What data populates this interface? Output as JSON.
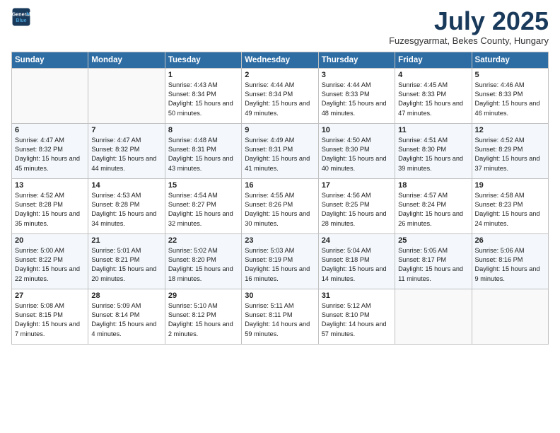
{
  "logo": {
    "line1": "General",
    "line2": "Blue"
  },
  "title": "July 2025",
  "location": "Fuzesgyarmat, Bekes County, Hungary",
  "days_of_week": [
    "Sunday",
    "Monday",
    "Tuesday",
    "Wednesday",
    "Thursday",
    "Friday",
    "Saturday"
  ],
  "weeks": [
    [
      {
        "day": "",
        "detail": ""
      },
      {
        "day": "",
        "detail": ""
      },
      {
        "day": "1",
        "detail": "Sunrise: 4:43 AM\nSunset: 8:34 PM\nDaylight: 15 hours\nand 50 minutes."
      },
      {
        "day": "2",
        "detail": "Sunrise: 4:44 AM\nSunset: 8:34 PM\nDaylight: 15 hours\nand 49 minutes."
      },
      {
        "day": "3",
        "detail": "Sunrise: 4:44 AM\nSunset: 8:33 PM\nDaylight: 15 hours\nand 48 minutes."
      },
      {
        "day": "4",
        "detail": "Sunrise: 4:45 AM\nSunset: 8:33 PM\nDaylight: 15 hours\nand 47 minutes."
      },
      {
        "day": "5",
        "detail": "Sunrise: 4:46 AM\nSunset: 8:33 PM\nDaylight: 15 hours\nand 46 minutes."
      }
    ],
    [
      {
        "day": "6",
        "detail": "Sunrise: 4:47 AM\nSunset: 8:32 PM\nDaylight: 15 hours\nand 45 minutes."
      },
      {
        "day": "7",
        "detail": "Sunrise: 4:47 AM\nSunset: 8:32 PM\nDaylight: 15 hours\nand 44 minutes."
      },
      {
        "day": "8",
        "detail": "Sunrise: 4:48 AM\nSunset: 8:31 PM\nDaylight: 15 hours\nand 43 minutes."
      },
      {
        "day": "9",
        "detail": "Sunrise: 4:49 AM\nSunset: 8:31 PM\nDaylight: 15 hours\nand 41 minutes."
      },
      {
        "day": "10",
        "detail": "Sunrise: 4:50 AM\nSunset: 8:30 PM\nDaylight: 15 hours\nand 40 minutes."
      },
      {
        "day": "11",
        "detail": "Sunrise: 4:51 AM\nSunset: 8:30 PM\nDaylight: 15 hours\nand 39 minutes."
      },
      {
        "day": "12",
        "detail": "Sunrise: 4:52 AM\nSunset: 8:29 PM\nDaylight: 15 hours\nand 37 minutes."
      }
    ],
    [
      {
        "day": "13",
        "detail": "Sunrise: 4:52 AM\nSunset: 8:28 PM\nDaylight: 15 hours\nand 35 minutes."
      },
      {
        "day": "14",
        "detail": "Sunrise: 4:53 AM\nSunset: 8:28 PM\nDaylight: 15 hours\nand 34 minutes."
      },
      {
        "day": "15",
        "detail": "Sunrise: 4:54 AM\nSunset: 8:27 PM\nDaylight: 15 hours\nand 32 minutes."
      },
      {
        "day": "16",
        "detail": "Sunrise: 4:55 AM\nSunset: 8:26 PM\nDaylight: 15 hours\nand 30 minutes."
      },
      {
        "day": "17",
        "detail": "Sunrise: 4:56 AM\nSunset: 8:25 PM\nDaylight: 15 hours\nand 28 minutes."
      },
      {
        "day": "18",
        "detail": "Sunrise: 4:57 AM\nSunset: 8:24 PM\nDaylight: 15 hours\nand 26 minutes."
      },
      {
        "day": "19",
        "detail": "Sunrise: 4:58 AM\nSunset: 8:23 PM\nDaylight: 15 hours\nand 24 minutes."
      }
    ],
    [
      {
        "day": "20",
        "detail": "Sunrise: 5:00 AM\nSunset: 8:22 PM\nDaylight: 15 hours\nand 22 minutes."
      },
      {
        "day": "21",
        "detail": "Sunrise: 5:01 AM\nSunset: 8:21 PM\nDaylight: 15 hours\nand 20 minutes."
      },
      {
        "day": "22",
        "detail": "Sunrise: 5:02 AM\nSunset: 8:20 PM\nDaylight: 15 hours\nand 18 minutes."
      },
      {
        "day": "23",
        "detail": "Sunrise: 5:03 AM\nSunset: 8:19 PM\nDaylight: 15 hours\nand 16 minutes."
      },
      {
        "day": "24",
        "detail": "Sunrise: 5:04 AM\nSunset: 8:18 PM\nDaylight: 15 hours\nand 14 minutes."
      },
      {
        "day": "25",
        "detail": "Sunrise: 5:05 AM\nSunset: 8:17 PM\nDaylight: 15 hours\nand 11 minutes."
      },
      {
        "day": "26",
        "detail": "Sunrise: 5:06 AM\nSunset: 8:16 PM\nDaylight: 15 hours\nand 9 minutes."
      }
    ],
    [
      {
        "day": "27",
        "detail": "Sunrise: 5:08 AM\nSunset: 8:15 PM\nDaylight: 15 hours\nand 7 minutes."
      },
      {
        "day": "28",
        "detail": "Sunrise: 5:09 AM\nSunset: 8:14 PM\nDaylight: 15 hours\nand 4 minutes."
      },
      {
        "day": "29",
        "detail": "Sunrise: 5:10 AM\nSunset: 8:12 PM\nDaylight: 15 hours\nand 2 minutes."
      },
      {
        "day": "30",
        "detail": "Sunrise: 5:11 AM\nSunset: 8:11 PM\nDaylight: 14 hours\nand 59 minutes."
      },
      {
        "day": "31",
        "detail": "Sunrise: 5:12 AM\nSunset: 8:10 PM\nDaylight: 14 hours\nand 57 minutes."
      },
      {
        "day": "",
        "detail": ""
      },
      {
        "day": "",
        "detail": ""
      }
    ]
  ]
}
